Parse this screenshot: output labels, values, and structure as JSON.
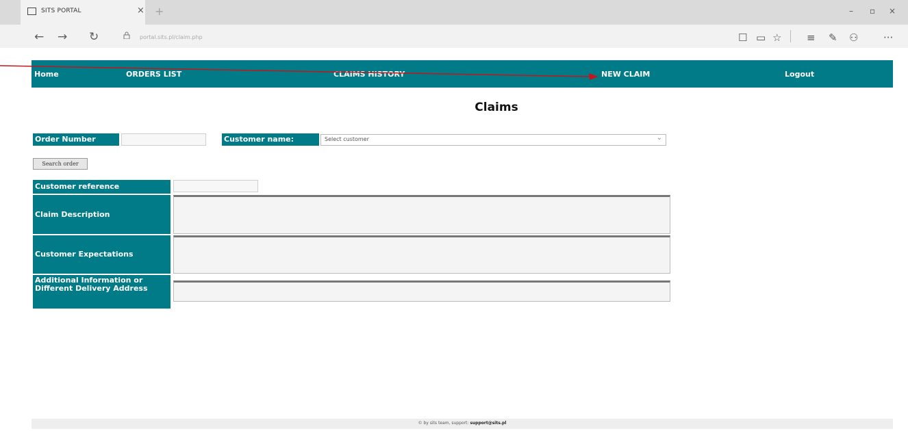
{
  "browser": {
    "tab_title": "SITS PORTAL",
    "tab_close": "×",
    "new_tab": "+",
    "url": "portal.sits.pl/claim.php",
    "window_controls": {
      "minimize": "–",
      "restore": "▫",
      "close": "×"
    },
    "nav": {
      "back": "←",
      "forward": "→",
      "refresh": "↻"
    },
    "tools": {
      "reading_view": "☐",
      "reading_list": "▭",
      "favorite": "☆",
      "hub": "≡",
      "notes": "✎",
      "share": "⚇",
      "more": "···"
    }
  },
  "nav": {
    "home": "Home",
    "orders_list": "ORDERS LIST",
    "claims_history": "CLAIMS HISTORY",
    "new_claim": "NEW CLAIM",
    "logout": "Logout"
  },
  "page": {
    "title": "Claims"
  },
  "form": {
    "order_number_label": "Order Number",
    "order_number_value": "",
    "customer_name_label": "Customer name:",
    "customer_select_value": "Select customer",
    "search_button": "Search order",
    "customer_reference_label": "Customer reference",
    "customer_reference_value": "",
    "claim_description_label": "Claim Description",
    "customer_expectations_label": "Customer Expectations",
    "additional_info_label": "Additional Information or Different Delivery Address"
  },
  "footer": {
    "text": "© by sits team, support:",
    "email": "support@sits.pl"
  },
  "colors": {
    "nav_bg": "#017b88",
    "annotation_arrow": "#c0171c"
  }
}
